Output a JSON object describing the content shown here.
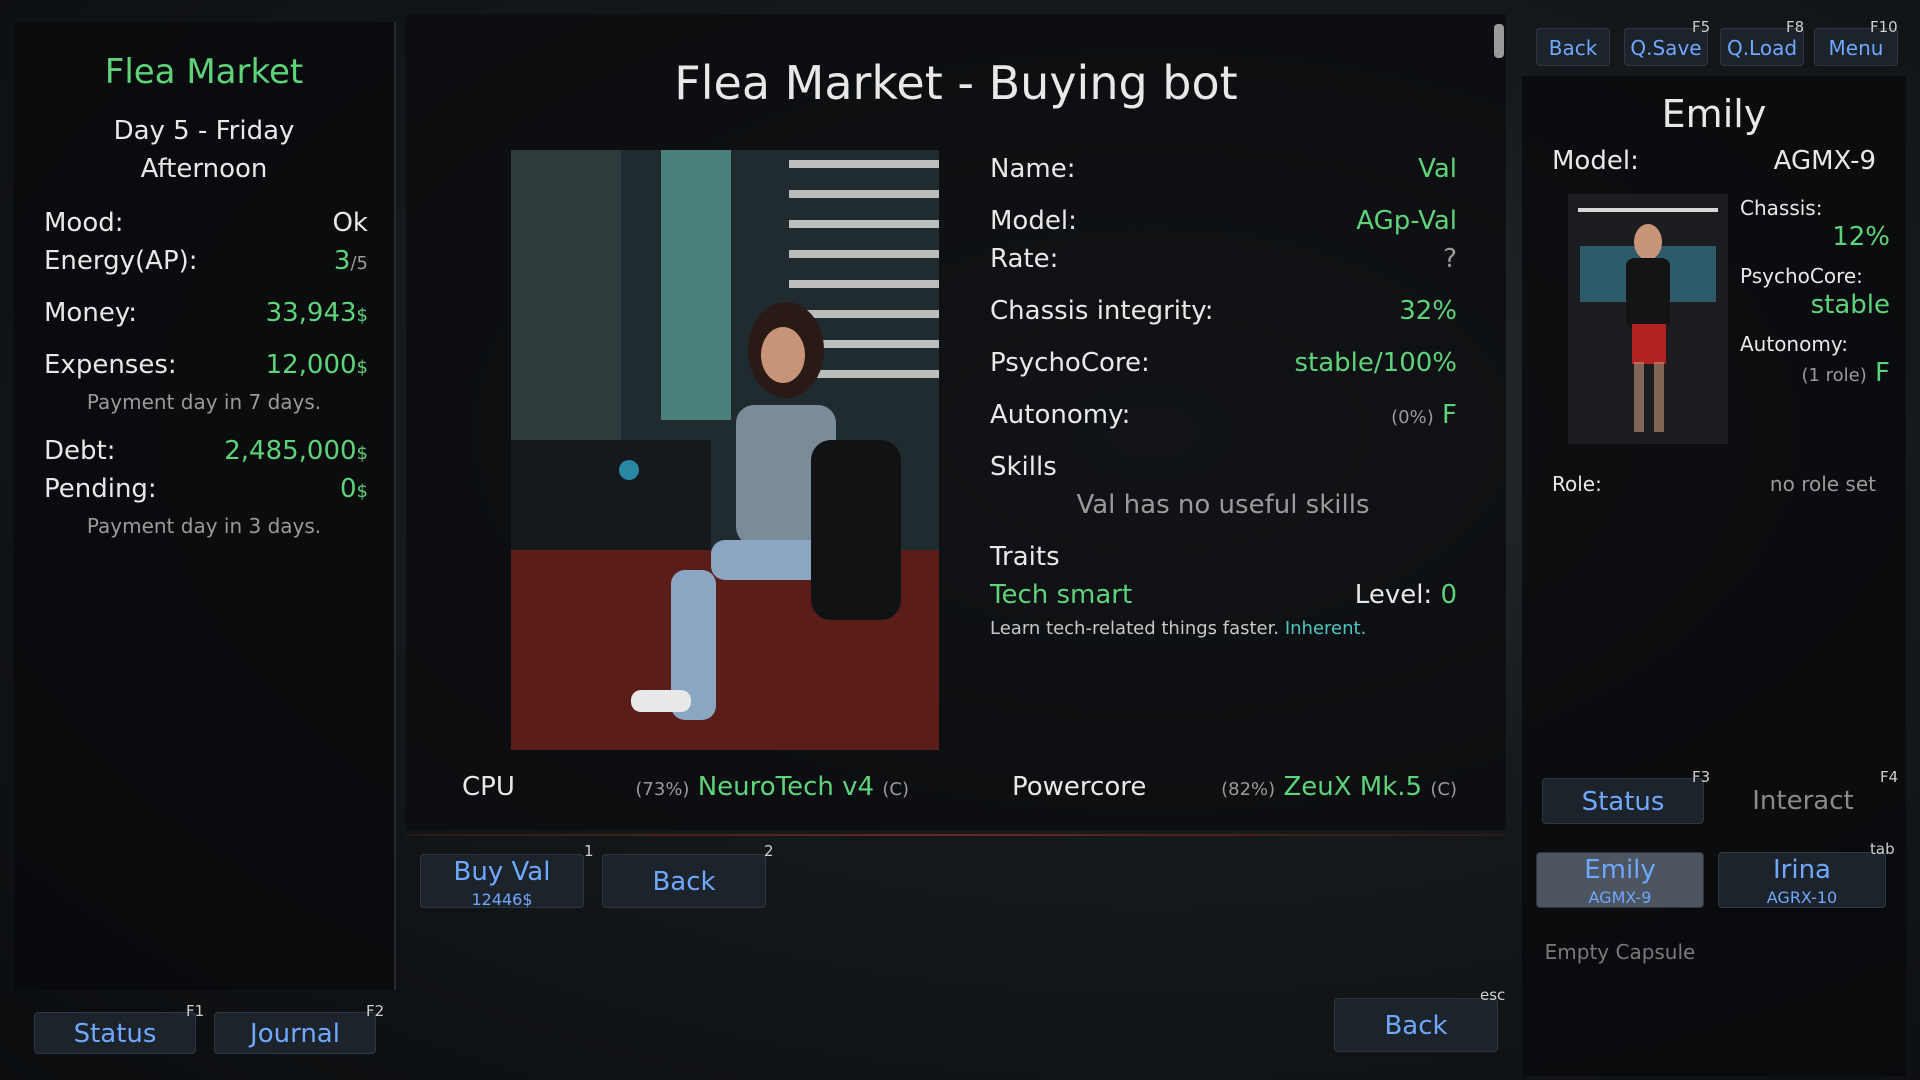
{
  "left": {
    "title": "Flea Market",
    "day": "Day 5 - Friday",
    "time": "Afternoon",
    "stats": {
      "mood_label": "Mood:",
      "mood_value": "Ok",
      "energy_label": "Energy(AP):",
      "energy_value": "3",
      "energy_max": "/5",
      "money_label": "Money:",
      "money_value": "33,943",
      "money_unit": "$",
      "expenses_label": "Expenses:",
      "expenses_value": "12,000",
      "expenses_unit": "$",
      "expenses_note": "Payment day in 7 days.",
      "debt_label": "Debt:",
      "debt_value": "2,485,000",
      "debt_unit": "$",
      "pending_label": "Pending:",
      "pending_value": "0",
      "pending_unit": "$",
      "pending_note": "Payment day in 3 days."
    },
    "buttons": {
      "status": "Status",
      "status_key": "F1",
      "journal": "Journal",
      "journal_key": "F2"
    }
  },
  "center": {
    "title": "Flea Market - Buying bot",
    "info": {
      "name_label": "Name:",
      "name_value": "Val",
      "model_label": "Model:",
      "model_value": "AGp-Val",
      "rate_label": "Rate:",
      "rate_value": "?",
      "chassis_label": "Chassis integrity:",
      "chassis_value": "32%",
      "psycho_label": "PsychoCore:",
      "psycho_state": "stable",
      "psycho_pct": "/100%",
      "autonomy_label": "Autonomy:",
      "autonomy_pct": "(0%)",
      "autonomy_grade": "F",
      "skills_label": "Skills",
      "skills_text": "Val has no useful skills",
      "traits_label": "Traits",
      "trait_name": "Tech smart",
      "trait_level_label": "Level:",
      "trait_level_value": "0",
      "trait_desc": "Learn tech-related things faster.",
      "trait_inherent": "Inherent."
    },
    "parts": {
      "cpu_label": "CPU",
      "cpu_pct": "(73%)",
      "cpu_name": "NeuroTech v4",
      "cpu_class": "(C)",
      "power_label": "Powercore",
      "power_pct": "(82%)",
      "power_name": "ZeuX Mk.5",
      "power_class": "(C)"
    },
    "actions": {
      "buy_label": "Buy Val",
      "buy_price": "12446$",
      "buy_key": "1",
      "back_label": "Back",
      "back_key": "2"
    },
    "bottom_back": "Back",
    "bottom_back_key": "esc"
  },
  "top_menu": {
    "back": "Back",
    "qsave": "Q.Save",
    "qsave_key": "F5",
    "qload": "Q.Load",
    "qload_key": "F8",
    "menu": "Menu",
    "menu_key": "F10"
  },
  "right": {
    "name": "Emily",
    "model_label": "Model:",
    "model_value": "AGMX-9",
    "chassis_label": "Chassis:",
    "chassis_value": "12%",
    "psycho_label": "PsychoCore:",
    "psycho_value": "stable",
    "autonomy_label": "Autonomy:",
    "autonomy_roles": "(1 role)",
    "autonomy_grade": "F",
    "role_label": "Role:",
    "role_value": "no role set",
    "tabs": {
      "status": "Status",
      "status_key": "F3",
      "interact": "Interact",
      "interact_key": "F4"
    },
    "bots": [
      {
        "name": "Emily",
        "model": "AGMX-9"
      },
      {
        "name": "Irina",
        "model": "AGRX-10"
      }
    ],
    "bots_key": "tab",
    "empty_capsule": "Empty Capsule"
  }
}
